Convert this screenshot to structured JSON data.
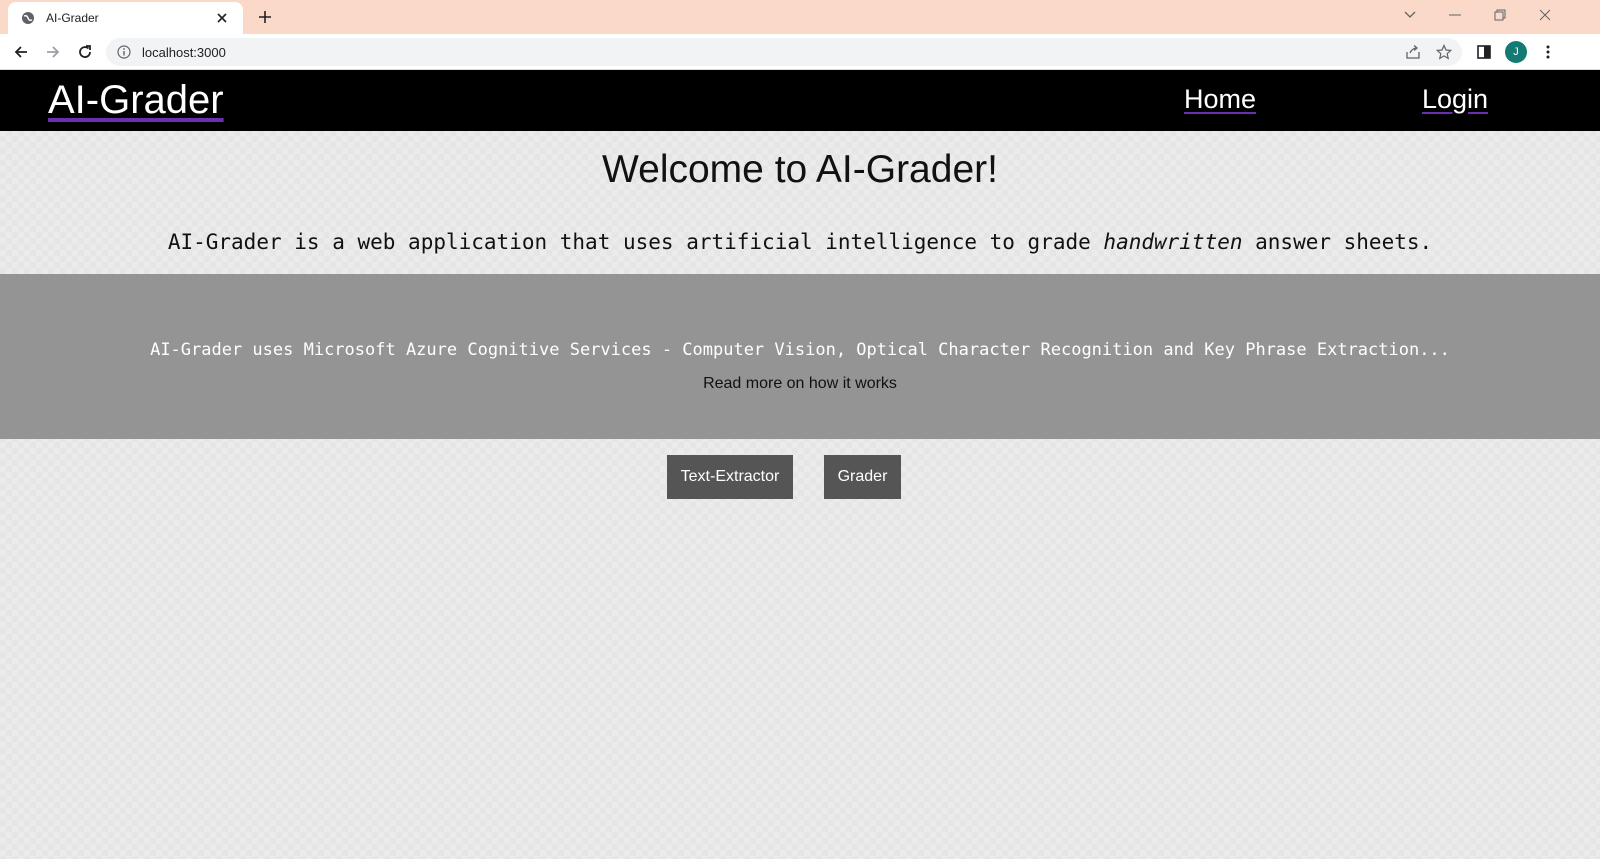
{
  "browser": {
    "tab_title": "AI-Grader",
    "url": "localhost:3000",
    "profile_initial": "J",
    "accent_tabstrip": "#fad9c9",
    "avatar_color": "#137b74"
  },
  "site": {
    "brand": "AI-Grader",
    "nav": {
      "home": "Home",
      "login": "Login"
    },
    "heading": "Welcome to AI-Grader!",
    "tagline": {
      "before": "AI-Grader is a web application that uses artificial intelligence to grade ",
      "emphasis": "handwritten",
      "after": " answer sheets."
    },
    "band": {
      "text": "AI-Grader uses Microsoft Azure Cognitive Services - Computer Vision, Optical Character Recognition and Key Phrase Extraction...",
      "read_more": "Read more on how it works",
      "color": "#949494"
    },
    "buttons": {
      "text_extractor": "Text-Extractor",
      "grader": "Grader"
    },
    "underline_color": "#6a2fb0"
  }
}
